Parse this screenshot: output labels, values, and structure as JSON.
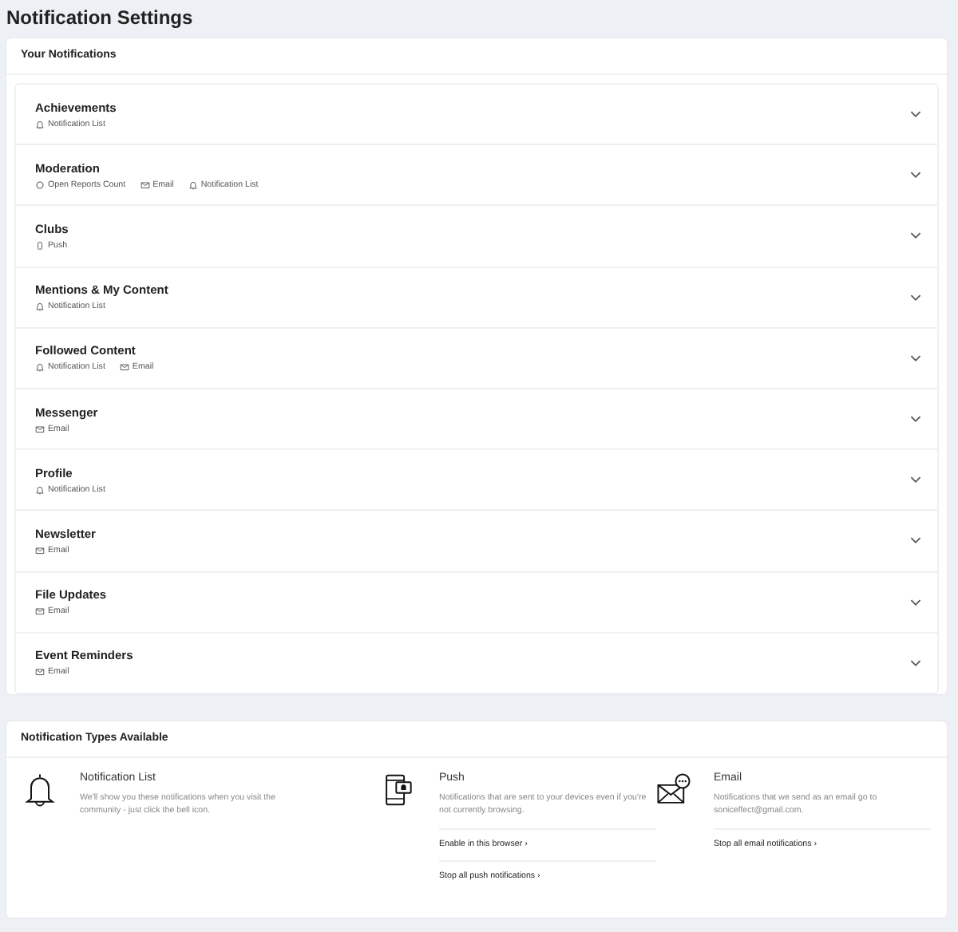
{
  "page_title": "Notification Settings",
  "your_notifications": {
    "title": "Your Notifications",
    "groups": [
      {
        "title": "Achievements",
        "methods": [
          {
            "kind": "bell",
            "label": "Notification List"
          }
        ]
      },
      {
        "title": "Moderation",
        "methods": [
          {
            "kind": "count",
            "label": "Open Reports Count"
          },
          {
            "kind": "email",
            "label": "Email"
          },
          {
            "kind": "bell",
            "label": "Notification List"
          }
        ]
      },
      {
        "title": "Clubs",
        "methods": [
          {
            "kind": "push",
            "label": "Push"
          }
        ]
      },
      {
        "title": "Mentions & My Content",
        "methods": [
          {
            "kind": "bell",
            "label": "Notification List"
          }
        ]
      },
      {
        "title": "Followed Content",
        "methods": [
          {
            "kind": "bell",
            "label": "Notification List"
          },
          {
            "kind": "email",
            "label": "Email"
          }
        ]
      },
      {
        "title": "Messenger",
        "methods": [
          {
            "kind": "email",
            "label": "Email"
          }
        ]
      },
      {
        "title": "Profile",
        "methods": [
          {
            "kind": "bell",
            "label": "Notification List"
          }
        ]
      },
      {
        "title": "Newsletter",
        "methods": [
          {
            "kind": "email",
            "label": "Email"
          }
        ]
      },
      {
        "title": "File Updates",
        "methods": [
          {
            "kind": "email",
            "label": "Email"
          }
        ]
      },
      {
        "title": "Event Reminders",
        "methods": [
          {
            "kind": "email",
            "label": "Email"
          }
        ]
      }
    ]
  },
  "types_available": {
    "title": "Notification Types Available",
    "types": [
      {
        "kind": "bell",
        "title": "Notification List",
        "description": "We'll show you these notifications when you visit the community - just click the bell icon."
      },
      {
        "kind": "push",
        "title": "Push",
        "description": "Notifications that are sent to your devices even if you're not currently browsing.",
        "links": [
          "Enable in this browser ›",
          "Stop all push notifications ›"
        ]
      },
      {
        "kind": "email",
        "title": "Email",
        "description": "Notifications that we send as an email go to soniceffect@gmail.com.",
        "links": [
          "Stop all email notifications ›"
        ]
      }
    ]
  }
}
